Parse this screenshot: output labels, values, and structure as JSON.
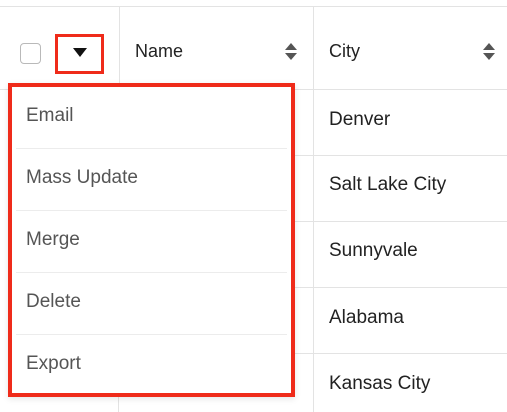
{
  "table": {
    "columns": [
      {
        "label": "Name"
      },
      {
        "label": "City"
      }
    ],
    "rows": [
      {
        "city": "Denver"
      },
      {
        "city": "Salt Lake City"
      },
      {
        "city": "Sunnyvale"
      },
      {
        "city": "Alabama"
      },
      {
        "city": "Kansas City"
      }
    ]
  },
  "actions_menu": {
    "items": [
      {
        "label": "Email"
      },
      {
        "label": "Mass Update"
      },
      {
        "label": "Merge"
      },
      {
        "label": "Delete"
      },
      {
        "label": "Export"
      }
    ]
  },
  "colors": {
    "highlight": "#ef2b1a",
    "border": "#e3e3e3",
    "menu_text": "#555555"
  },
  "icons": {
    "actions_toggle": "caret-down-icon",
    "sort": "sort-icon"
  }
}
